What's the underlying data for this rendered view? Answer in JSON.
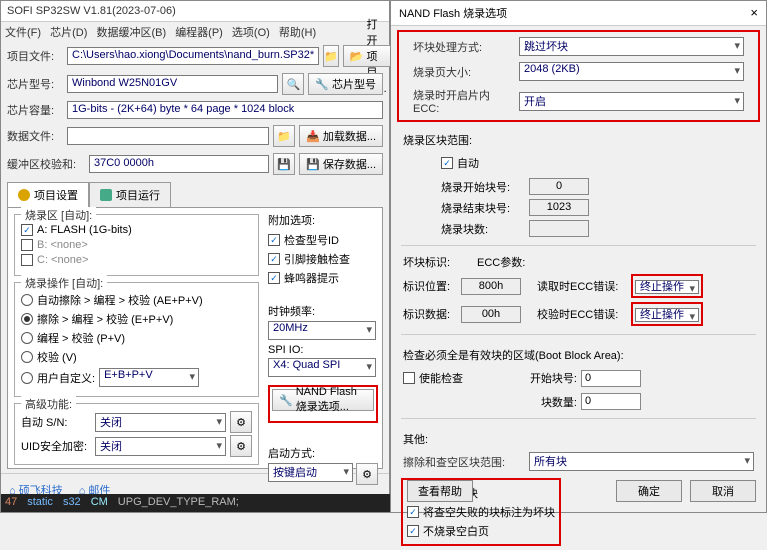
{
  "main": {
    "title": "SOFI SP32SW V1.81(2023-07-06)",
    "menu": [
      "文件(F)",
      "芯片(D)",
      "数据缓冲区(B)",
      "编程器(P)",
      "选项(O)",
      "帮助(H)"
    ],
    "project_file_label": "项目文件:",
    "project_file_value": "C:\\Users\\hao.xiong\\Documents\\nand_burn.SP32*",
    "open_project_btn": "打开项目文...",
    "chip_model_label": "芯片型号:",
    "chip_model_value": "Winbond W25N01GV",
    "chip_model_btn": "芯片型号",
    "chip_capacity_label": "芯片容量:",
    "chip_capacity_value": "1G-bits - (2K+64) byte * 64 page * 1024 block",
    "data_file_label": "数据文件:",
    "load_data_btn": "加载数据...",
    "buffer_checksum_label": "缓冲区校验和:",
    "buffer_checksum_value": "37C0 0000h",
    "save_data_btn": "保存数据...",
    "tabs": {
      "settings": "项目设置",
      "run": "项目运行"
    },
    "burn_area_title": "烧录区 [自动]:",
    "areas": {
      "a": "A: FLASH (1G-bits)",
      "b": "B: <none>",
      "c": "C: <none>"
    },
    "burn_op_title": "烧录操作 [自动]:",
    "ops": {
      "auto_erase": "自动擦除 > 编程 > 校验 (AE+P+V)",
      "erase_prog": "擦除 > 编程 > 校验 (E+P+V)",
      "prog_ver": "编程 > 校验 (P+V)",
      "verify": "校验 (V)",
      "user_def_label": "用户自定义:",
      "user_def_value": "E+B+P+V"
    },
    "adv_title": "高级功能:",
    "auto_sn_label": "自动 S/N:",
    "uid_label": "UID安全加密:",
    "closed": "关闭",
    "extra_title": "附加选项:",
    "extra_opts": [
      "检查型号ID",
      "引脚接触检查",
      "蜂鸣器提示"
    ],
    "clock_label": "时钟频率:",
    "clock_value": "20MHz",
    "spi_io_label": "SPI IO:",
    "spi_io_value": "X4: Quad SPI",
    "nand_btn": "NAND Flash 烧录选项...",
    "start_mode_label": "启动方式:",
    "start_mode_value": "按键启动",
    "links": {
      "tech": "硕飞科技",
      "mail": "邮件"
    },
    "status": {
      "line": "47",
      "kw": "static",
      "type": "s32",
      "var": "UPG_DEV_TYPE_RAM;"
    }
  },
  "dlg": {
    "title": "NAND Flash 烧录选项",
    "bad_block_label": "坏块处理方式:",
    "bad_block_value": "跳过坏块",
    "page_size_label": "烧录页大小:",
    "page_size_value": "2048 (2KB)",
    "ecc_label": "烧录时开启片内ECC:",
    "ecc_value": "开启",
    "range_title": "烧录区块范围:",
    "auto": "自动",
    "start_block_label": "烧录开始块号:",
    "start_block_value": "0",
    "end_block_label": "烧录结束块号:",
    "end_block_value": "1023",
    "block_count_label": "烧录块数:",
    "bad_mark_title": "坏块标识:",
    "ecc_param_title": "ECC参数:",
    "mark_pos_label": "标识位置:",
    "mark_pos_value": "800h",
    "read_ecc_err_label": "读取时ECC错误:",
    "stop_op": "终止操作",
    "mark_count_label": "标识数据:",
    "mark_count_value": "00h",
    "verify_ecc_err_label": "校验时ECC错误:",
    "boot_check_label": "检查必须全是有效块的区域(Boot Block Area):",
    "enable_check": "使能检查",
    "start_block2_label": "开始块号:",
    "block_count2_label": "块数量:",
    "zero": "0",
    "other_title": "其他:",
    "erase_blank_label": "擦除和查空区块范围:",
    "all_blocks": "所有块",
    "chk1": "不擦除坏块",
    "chk2": "将查空失败的块标注为坏块",
    "chk3": "不烧录空白页",
    "help_btn": "查看帮助",
    "ok_btn": "确定",
    "cancel_btn": "取消"
  }
}
